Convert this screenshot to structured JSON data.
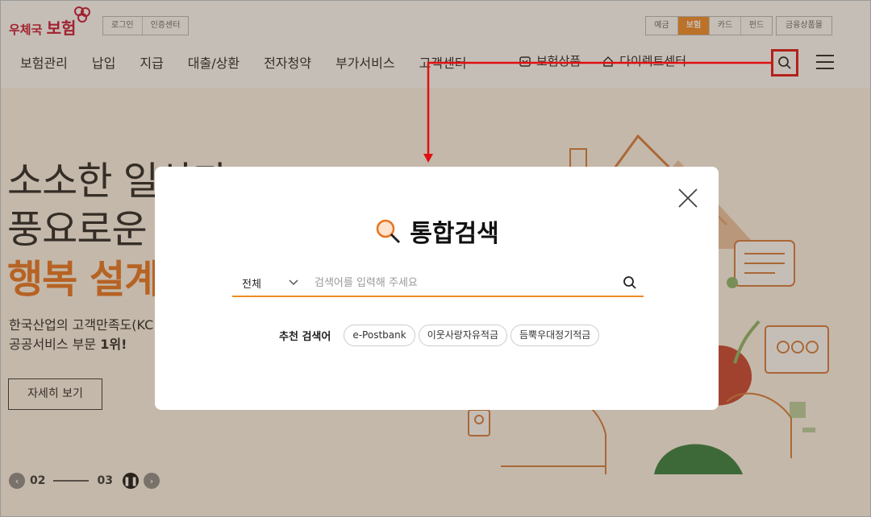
{
  "header": {
    "logo_prefix": "우체국",
    "logo_main": "보험",
    "util_links": [
      "로그인",
      "인증센터"
    ],
    "service_tabs": [
      {
        "label": "예금",
        "active": false
      },
      {
        "label": "보험",
        "active": true
      },
      {
        "label": "카드",
        "active": false
      },
      {
        "label": "펀드",
        "active": false
      }
    ],
    "fin_mall": "금융상품몰",
    "nav": [
      "보험관리",
      "납입",
      "지급",
      "대출/상환",
      "전자청약",
      "부가서비스",
      "고객센터"
    ],
    "nav_right": [
      {
        "label": "보험상품",
        "icon": "product-icon"
      },
      {
        "label": "다이렉트센터",
        "icon": "direct-icon"
      }
    ],
    "search_icon": "search-icon",
    "menu_icon": "hamburger-icon"
  },
  "hero": {
    "line1": "소소한 일상과",
    "line2": "풍요로운",
    "line3": "행복 설계",
    "desc1": "한국산업의 고객만족도(KC",
    "desc2_prefix": "공공서비스 부문 ",
    "desc2_strong": "1위!",
    "button": "자세히 보기",
    "pager": {
      "current": "02",
      "total": "03"
    }
  },
  "modal": {
    "title": "통합검색",
    "select_value": "전체",
    "placeholder": "검색어를 입력해 주세요",
    "rec_label": "추천 검색어",
    "keywords": [
      "e-Postbank",
      "이웃사랑자유적금",
      "듬뿍우대정기적금"
    ]
  },
  "colors": {
    "brand": "#c8102e",
    "accent": "#f08a24",
    "annotation": "#e01010"
  }
}
